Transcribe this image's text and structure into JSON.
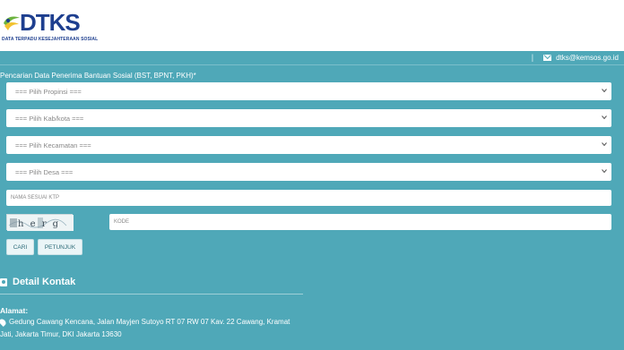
{
  "header": {
    "logo_text": "DTKS",
    "logo_subtitle": "DATA TERPADU KESEJAHTERAAN SOSIAL",
    "email": "dtks@kemsos.go.id",
    "separator": "|"
  },
  "form": {
    "title": "Pencarian Data Penerima Bantuan Sosial (BST, BPNT, PKH)*",
    "selects": [
      {
        "label": "=== Pilih Propinsi ==="
      },
      {
        "label": "=== Pilih Kab/kota ==="
      },
      {
        "label": "=== Pilih Kecamatan ==="
      },
      {
        "label": "=== Pilih Desa ==="
      }
    ],
    "name_placeholder": "NAMA SESUAI KTP",
    "captcha_text": "h e r g",
    "code_placeholder": "KODE",
    "buttons": {
      "search": "CARI",
      "guide": "PETUNJUK"
    }
  },
  "contact": {
    "heading": "Detail Kontak",
    "address_label": "Alamat:",
    "address_line1": "Gedung Cawang Kencana, Jalan Mayjen Sutoyo RT 07 RW 07 Kav. 22 Cawang, Kramat",
    "address_line2": "Jati, Jakarta Timur, DKI Jakarta 13630"
  },
  "colors": {
    "background": "#4fa8b8",
    "logo": "#1e3f8f",
    "logo_accent_green": "#6cb33f",
    "logo_accent_yellow": "#f2c230"
  }
}
